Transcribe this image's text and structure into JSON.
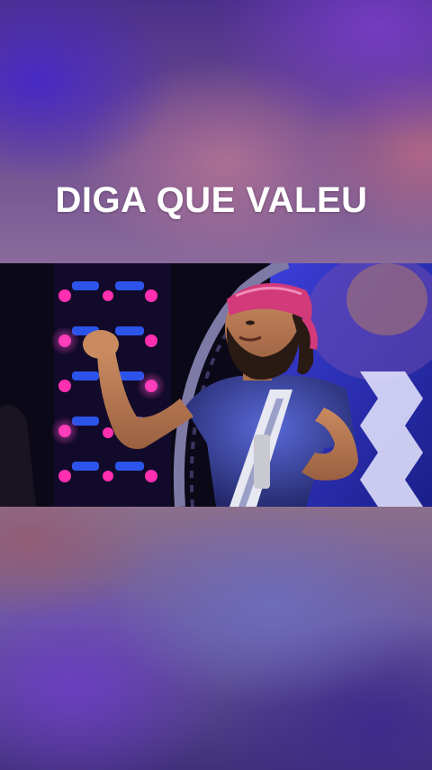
{
  "caption": {
    "title": "DIGA QUE VALEU"
  },
  "video": {
    "subject": "concert-performer-photo"
  },
  "colors": {
    "title_text": "#ffffff",
    "stage_magenta": "#ff2fb0",
    "stage_blue": "#2f5cff"
  }
}
